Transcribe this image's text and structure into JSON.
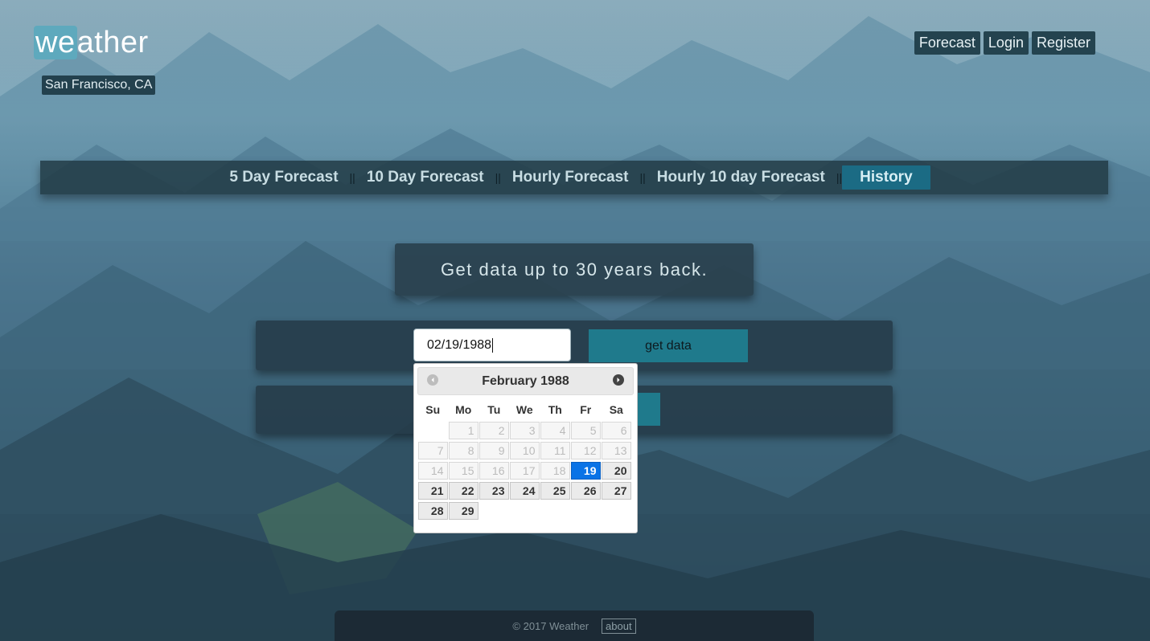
{
  "brand": {
    "logo_prefix": "we",
    "logo_suffix": "ather",
    "location": "San Francisco, CA"
  },
  "topnav": {
    "items": [
      "Forecast",
      "Login",
      "Register"
    ]
  },
  "tabs": {
    "items": [
      "5 Day Forecast",
      "10 Day Forecast",
      "Hourly Forecast",
      "Hourly 10 day Forecast",
      "History"
    ],
    "separator": "||",
    "active": "History"
  },
  "banner": {
    "text": "Get data up to 30 years back."
  },
  "form": {
    "date_value": "02/19/1988",
    "submit_label": "get data"
  },
  "datepicker": {
    "title": "February 1988",
    "weekdays": [
      "Su",
      "Mo",
      "Tu",
      "We",
      "Th",
      "Fr",
      "Sa"
    ],
    "leading_blanks": 1,
    "days": [
      {
        "d": "1",
        "state": "disabled"
      },
      {
        "d": "2",
        "state": "disabled"
      },
      {
        "d": "3",
        "state": "disabled"
      },
      {
        "d": "4",
        "state": "disabled"
      },
      {
        "d": "5",
        "state": "disabled"
      },
      {
        "d": "6",
        "state": "disabled"
      },
      {
        "d": "7",
        "state": "disabled"
      },
      {
        "d": "8",
        "state": "disabled"
      },
      {
        "d": "9",
        "state": "disabled"
      },
      {
        "d": "10",
        "state": "disabled"
      },
      {
        "d": "11",
        "state": "disabled"
      },
      {
        "d": "12",
        "state": "disabled"
      },
      {
        "d": "13",
        "state": "disabled"
      },
      {
        "d": "14",
        "state": "disabled"
      },
      {
        "d": "15",
        "state": "disabled"
      },
      {
        "d": "16",
        "state": "disabled"
      },
      {
        "d": "17",
        "state": "disabled"
      },
      {
        "d": "18",
        "state": "disabled"
      },
      {
        "d": "19",
        "state": "selected"
      },
      {
        "d": "20",
        "state": "enabled"
      },
      {
        "d": "21",
        "state": "enabled"
      },
      {
        "d": "22",
        "state": "enabled"
      },
      {
        "d": "23",
        "state": "enabled"
      },
      {
        "d": "24",
        "state": "enabled"
      },
      {
        "d": "25",
        "state": "enabled"
      },
      {
        "d": "26",
        "state": "enabled"
      },
      {
        "d": "27",
        "state": "enabled"
      },
      {
        "d": "28",
        "state": "enabled"
      },
      {
        "d": "29",
        "state": "enabled"
      }
    ],
    "colors": {
      "selected": "#0a73e6",
      "enabled": "#ebebeb"
    }
  },
  "footer": {
    "copyright": "© 2017 Weather",
    "about_label": "about"
  },
  "colors": {
    "accent": "#1f7a8c",
    "active_tab": "#1b6b84",
    "logo_highlight": "#5ea9bd"
  }
}
